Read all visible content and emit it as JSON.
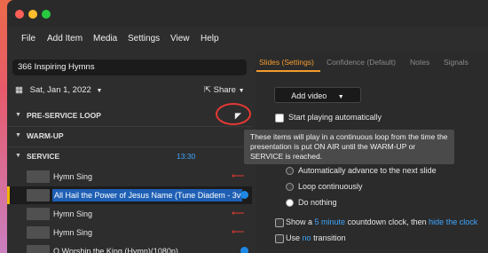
{
  "menu": [
    "File",
    "Add Item",
    "Media",
    "Settings",
    "View",
    "Help"
  ],
  "service_name": "366 Inspiring Hymns",
  "date": "Sat, Jan 1, 2022",
  "share_label": "Share",
  "sections": {
    "pre_service": "PRE-SERVICE LOOP",
    "warm_up": "WARM-UP",
    "service": "SERVICE",
    "service_time": "13:30"
  },
  "items": [
    "Hymn Sing",
    "All Hail the Power of Jesus  Name (Tune  Diadem - 3v",
    "Hymn Sing",
    "Hymn Sing",
    "O Worship the King (Hymn)(1080p)"
  ],
  "tabs": [
    "Slides (Settings)",
    "Confidence (Default)",
    "Notes",
    "Signals"
  ],
  "add_video": "Add video",
  "start_playing": "Start playing automatically",
  "tooltip": "These items will play in a continuous loop from the time the presentation is put ON AIR until the WARM-UP or SERVICE is reached.",
  "options": [
    "Automatically advance to the next slide",
    "Loop continuously",
    "Do nothing"
  ],
  "countdown": {
    "prefix": "Show a",
    "link1": "5 minute",
    "middle": "countdown clock, then",
    "link2": "hide the clock"
  },
  "transition": {
    "prefix": "Use",
    "link": "no",
    "suffix": "transition"
  },
  "colors": {
    "accent": "#f39c2e",
    "link": "#3ea6ff",
    "marker": "#e53935"
  }
}
